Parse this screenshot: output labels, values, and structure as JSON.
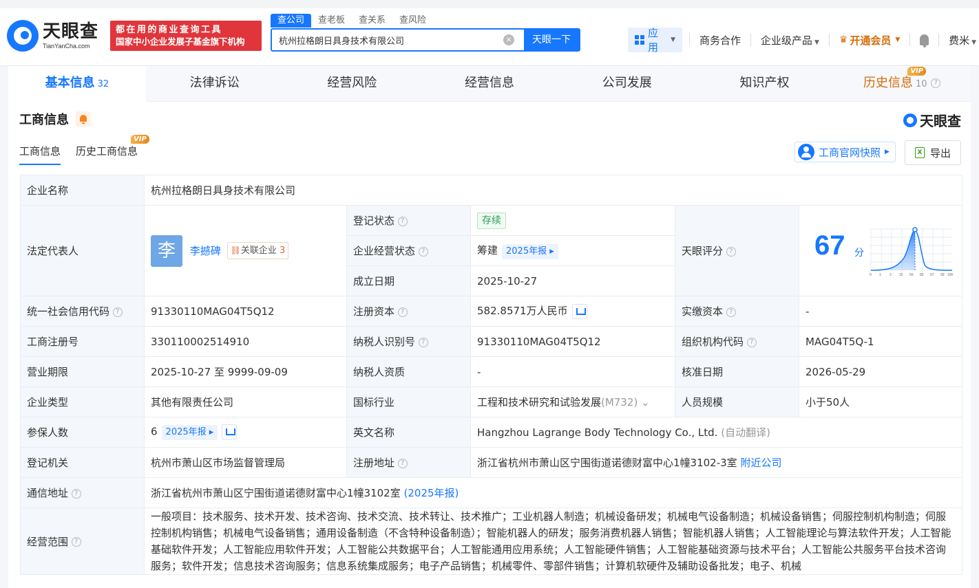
{
  "header": {
    "logo_cn": "天眼查",
    "logo_en": "TianYanCha.com",
    "slogan_line1": "都在用的商业查询工具",
    "slogan_line2": "国家中小企业发展子基金旗下机构",
    "search_tabs": [
      "查公司",
      "查老板",
      "查关系",
      "查风险"
    ],
    "search_value": "杭州拉格朗日具身技术有限公司",
    "search_button": "天眼一下",
    "nav": {
      "apps": "应用",
      "business": "商务合作",
      "products": "企业级产品",
      "vip": "开通会员",
      "user": "费米"
    }
  },
  "tabs": [
    {
      "label": "基本信息",
      "count": "32"
    },
    {
      "label": "法律诉讼",
      "count": ""
    },
    {
      "label": "经营风险",
      "count": ""
    },
    {
      "label": "经营信息",
      "count": ""
    },
    {
      "label": "公司发展",
      "count": ""
    },
    {
      "label": "知识产权",
      "count": ""
    },
    {
      "label": "历史信息",
      "count": "10"
    }
  ],
  "vip_label": "VIP",
  "section": {
    "title": "工商信息",
    "brand": "天眼查",
    "subtabs": [
      "工商信息",
      "历史工商信息"
    ],
    "snapshot": "工商官网快照",
    "export": "导出"
  },
  "info": {
    "company_name_label": "企业名称",
    "company_name": "杭州拉格朗日具身技术有限公司",
    "legal_rep_label": "法定代表人",
    "legal_rep_avatar": "李",
    "legal_rep_name": "李撼碑",
    "related_label": "关联企业",
    "related_count": "3",
    "reg_status_label": "登记状态",
    "reg_status": "存续",
    "op_status_label": "企业经营状态",
    "op_status": "筹建",
    "annual_report": "2025年报",
    "founded_label": "成立日期",
    "founded": "2025-10-27",
    "score_label": "天眼评分",
    "score": "67",
    "score_unit": "分",
    "score_ticks": [
      "0",
      "1",
      "3",
      "15",
      "50",
      "85",
      "97",
      "99",
      "100"
    ],
    "credit_code_label": "统一社会信用代码",
    "credit_code": "91330110MAG04T5Q12",
    "reg_capital_label": "注册资本",
    "reg_capital": "582.8571万人民币",
    "paid_capital_label": "实缴资本",
    "paid_capital": "-",
    "reg_no_label": "工商注册号",
    "reg_no": "330110002514910",
    "tax_id_label": "纳税人识别号",
    "tax_id": "91330110MAG04T5Q12",
    "org_code_label": "组织机构代码",
    "org_code": "MAG04T5Q-1",
    "term_label": "营业期限",
    "term": "2025-10-27 至 9999-09-09",
    "taxpayer_label": "纳税人资质",
    "taxpayer": "-",
    "approve_label": "核准日期",
    "approve": "2026-05-29",
    "type_label": "企业类型",
    "type": "其他有限责任公司",
    "industry_label": "国标行业",
    "industry": "工程和技术研究和试验发展",
    "industry_code": "(M732)",
    "staff_label": "人员规模",
    "staff": "小于50人",
    "insured_label": "参保人数",
    "insured": "6",
    "en_name_label": "英文名称",
    "en_name": "Hangzhou Lagrange Body Technology Co., Ltd.",
    "auto_translate": "(自动翻译)",
    "authority_label": "登记机关",
    "authority": "杭州市萧山区市场监督管理局",
    "address_label": "注册地址",
    "address": "浙江省杭州市萧山区宁围街道诺德财富中心1幢3102-3室",
    "nearby": "附近公司",
    "mail_label": "通信地址",
    "mail_address": "浙江省杭州市萧山区宁围街道诺德财富中心1幢3102室",
    "mail_report": "(2025年报)",
    "scope_label": "经营范围",
    "scope": "一般项目：技术服务、技术开发、技术咨询、技术交流、技术转让、技术推广；工业机器人制造；机械设备研发；机械电气设备制造；机械设备销售；伺服控制机构制造；伺服控制机构销售；机械电气设备销售；通用设备制造（不含特种设备制造）；智能机器人的研发；服务消费机器人销售；智能机器人销售；人工智能理论与算法软件开发；人工智能基础软件开发；人工智能应用软件开发；人工智能公共数据平台；人工智能通用应用系统；人工智能硬件销售；人工智能基础资源与技术平台；人工智能公共服务平台技术咨询服务；软件开发；信息技术咨询服务；信息系统集成服务；电子产品销售；机械零件、零部件销售；计算机软硬件及辅助设备批发；电子、机械"
  },
  "colors": {
    "accent": "#1677ff",
    "vip": "#d46b08",
    "slogan_bg": "#e0353b"
  }
}
